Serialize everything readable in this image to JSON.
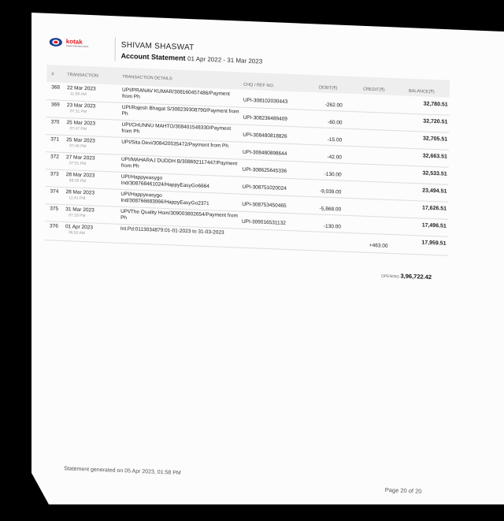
{
  "bank": {
    "name": "kotak",
    "tagline": "Kotak Mahindra Bank"
  },
  "account_holder": "SHIVAM SHASWAT",
  "statement": {
    "title": "Account Statement",
    "period": "01 Apr 2022 - 31 Mar 2023"
  },
  "table": {
    "headers": {
      "num": "#",
      "transaction": "TRANSACTION",
      "details": "TRANSACTION DETAILS",
      "ref": "CHQ / REF NO.",
      "debit": "DEBIT(₹)",
      "credit": "CREDIT(₹)",
      "balance": "BALANCE(₹)"
    },
    "rows": [
      {
        "num": "368",
        "date": "22 Mar 2023",
        "time": "11:09 AM",
        "details": "UPI/PRANAV KUMAR/308160457486/Payment from Ph",
        "ref": "UPI-308102030443",
        "debit": "-262.00",
        "credit": "",
        "balance": "32,780.51"
      },
      {
        "num": "369",
        "date": "23 Mar 2023",
        "time": "07:31 PM",
        "details": "UPI/Rajesh Bhagat S/308239308790/Payment from Ph",
        "ref": "UPI-308236489409",
        "debit": "-60.00",
        "credit": "",
        "balance": "32,720.51"
      },
      {
        "num": "370",
        "date": "25 Mar 2023",
        "time": "07:47 PM",
        "details": "UPI/CHUNNU MAHTO/308401548330/Payment from Ph",
        "ref": "UPI-308480818826",
        "debit": "-15.00",
        "credit": "",
        "balance": "32,705.51"
      },
      {
        "num": "371",
        "date": "25 Mar 2023",
        "time": "07:49 PM",
        "details": "UPI/Sita Devi/308420535472/Payment from Ph",
        "ref": "UPI-308480898644",
        "debit": "-42.00",
        "credit": "",
        "balance": "32,663.51"
      },
      {
        "num": "372",
        "date": "27 Mar 2023",
        "time": "07:51 PM",
        "details": "UPI/MAHARAJ DUDDH B/308692117447/Payment from Ph",
        "ref": "UPI-308625645336",
        "debit": "-130.00",
        "credit": "",
        "balance": "32,533.51"
      },
      {
        "num": "373",
        "date": "28 Mar 2023",
        "time": "08:29 PM",
        "details": "UPI/Happyeasygo Ind/308768461024/HappyEasyGo6664",
        "ref": "UPI-308751020024",
        "debit": "-9,039.00",
        "credit": "",
        "balance": "23,494.51"
      },
      {
        "num": "374",
        "date": "28 Mar 2023",
        "time": "11:41 PM",
        "details": "UPI/Happyeasygo Ind/308766683066/HappyEasyGo2371",
        "ref": "UPI-308753450465",
        "debit": "-5,868.00",
        "credit": "",
        "balance": "17,626.51"
      },
      {
        "num": "375",
        "date": "31 Mar 2023",
        "time": "07:29 PM",
        "details": "UPI/The Quality Hom/309003802654/Payment from Ph",
        "ref": "UPI-309016531132",
        "debit": "-130.00",
        "credit": "",
        "balance": "17,496.51"
      },
      {
        "num": "376",
        "date": "01 Apr 2023",
        "time": "06:50 AM",
        "details": "Int.Pd:0113034879:01-01-2023 to 31-03-2023",
        "ref": "",
        "debit": "",
        "credit": "+463.00",
        "balance": "17,959.51"
      }
    ]
  },
  "opening": {
    "label": "OPENING",
    "value": "3,96,722.42"
  },
  "footer": {
    "generated": "Statement generated on 05 Apr 2023, 01:58 PM",
    "page": "Page 20 of  20"
  }
}
